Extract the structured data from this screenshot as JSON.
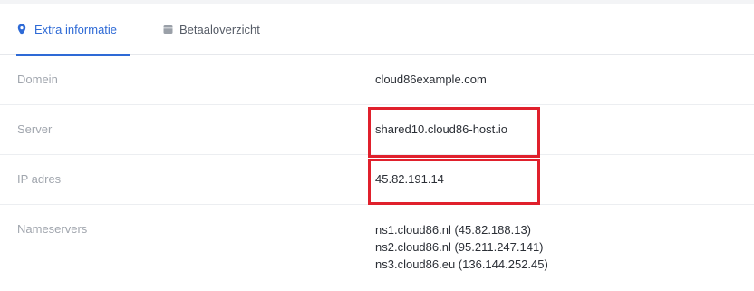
{
  "tabs": [
    {
      "label": "Extra informatie",
      "icon": "location-pin-icon",
      "active": true
    },
    {
      "label": "Betaaloverzicht",
      "icon": "card-icon",
      "active": false
    }
  ],
  "details": {
    "domain": {
      "label": "Domein",
      "value": "cloud86example.com"
    },
    "server": {
      "label": "Server",
      "value": "shared10.cloud86-host.io"
    },
    "ip": {
      "label": "IP adres",
      "value": "45.82.191.14"
    },
    "nameservers": {
      "label": "Nameservers",
      "values": [
        "ns1.cloud86.nl (45.82.188.13)",
        "ns2.cloud86.nl (95.211.247.141)",
        "ns3.cloud86.eu (136.144.252.45)"
      ]
    }
  },
  "colors": {
    "accent": "#2e6ad6",
    "highlight": "#e0202c",
    "label": "#a1a6ae",
    "text": "#2b2f36"
  }
}
